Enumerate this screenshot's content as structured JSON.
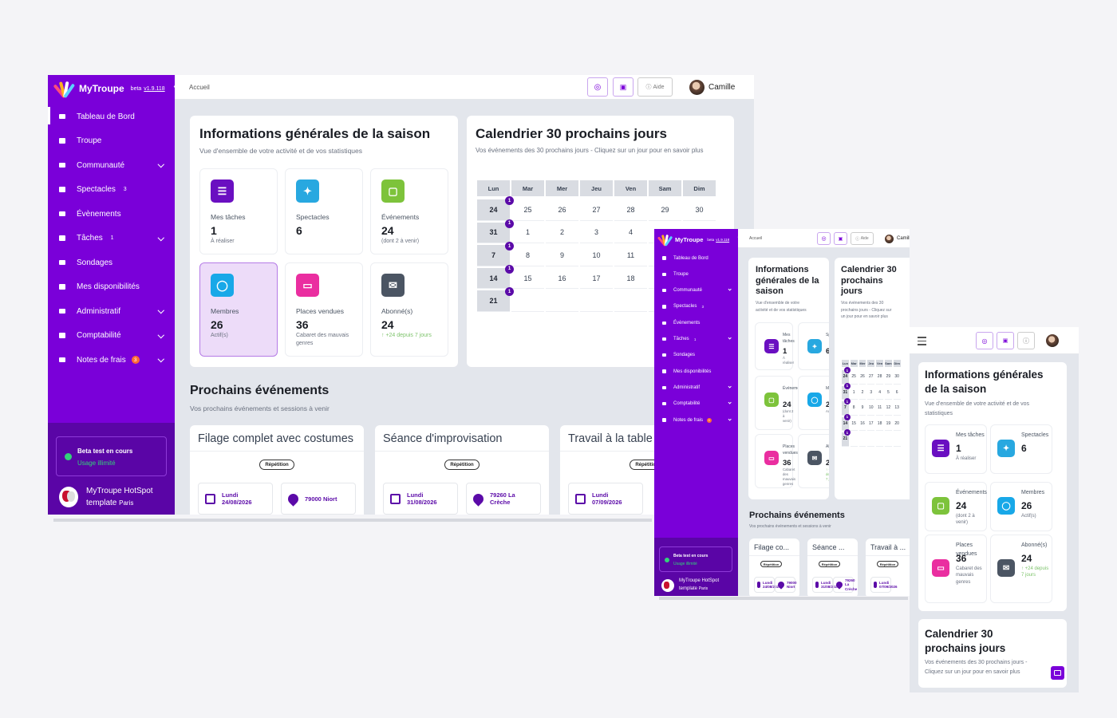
{
  "app": {
    "name": "MyTroupe",
    "beta": "beta",
    "version": "v1.9.118"
  },
  "breadcrumb": "Accueil",
  "topbar": {
    "help": "Aide",
    "user": "Camille"
  },
  "sidebar": {
    "items": [
      {
        "label": "Tableau de Bord",
        "icon": "chart-icon"
      },
      {
        "label": "Troupe",
        "icon": "home-icon"
      },
      {
        "label": "Communauté",
        "icon": "users-icon",
        "chevron": true
      },
      {
        "label": "Spectacles",
        "icon": "video-icon",
        "count": "3"
      },
      {
        "label": "Évènements",
        "icon": "calendar-icon"
      },
      {
        "label": "Tâches",
        "icon": "bookmark-icon",
        "count": "1",
        "chevron": true
      },
      {
        "label": "Sondages",
        "icon": "clipboard-icon"
      },
      {
        "label": "Mes disponibilités",
        "icon": "check-icon"
      },
      {
        "label": "Administratif",
        "icon": "folder-icon",
        "chevron": true
      },
      {
        "label": "Comptabilité",
        "icon": "calculator-icon",
        "chevron": true
      },
      {
        "label": "Notes de frais",
        "icon": "receipt-icon",
        "badge": "3",
        "chevron": true
      }
    ],
    "beta_title": "Beta test en cours",
    "beta_sub": "Usage illimité",
    "org_name": "MyTroupe HotSpot template",
    "org_city": "Paris"
  },
  "season": {
    "title": "Informations générales de la saison",
    "subtitle": "Vue d'ensemble de votre activité et de vos statistiques",
    "title_s2": [
      "Informations",
      "générales de la",
      "saison"
    ],
    "subtitle_s2": [
      "Vue d'ensemble de votre",
      "activité et de vos statistiques"
    ],
    "title_s3": [
      "Informations générales",
      "de la saison"
    ],
    "subtitle_s3": [
      "Vue d'ensemble de votre activité et de vos",
      "statistiques"
    ],
    "stats": [
      {
        "label": "Mes tâches",
        "value": "1",
        "sub": "À réaliser",
        "color": "#6a0fc1",
        "icon": "list-icon"
      },
      {
        "label": "Spectacles",
        "value": "6",
        "sub": "",
        "color": "#28a8e0",
        "icon": "sparkle-icon"
      },
      {
        "label": "Événements",
        "value": "24",
        "sub": "(dont 2 à venir)",
        "color": "#7dc33b",
        "icon": "calendar-icon"
      },
      {
        "label": "Membres",
        "value": "26",
        "sub": "Actif(s)",
        "color": "#18a8e8",
        "icon": "user-icon"
      },
      {
        "label": "Places vendues",
        "value": "36",
        "sub": "Cabaret des mauvais genres",
        "color": "#ea2ea0",
        "icon": "ticket-icon"
      },
      {
        "label": "Abonné(s)",
        "value": "24",
        "sub": "↑ +24 depuis 7 jours",
        "color": "#4b5563",
        "icon": "mail-icon"
      }
    ]
  },
  "calendar": {
    "title": "Calendrier 30 prochains jours",
    "subtitle": "Vos événements des 30 prochains jours - Cliquez sur un jour pour en savoir plus",
    "title_s2": [
      "Calendrier 30",
      "prochains",
      "jours"
    ],
    "subtitle_s2": [
      "Vos événements des 30",
      "prochains jours - Cliquez sur",
      "un jour pour en savoir plus"
    ],
    "title_s3": [
      "Calendrier 30",
      "prochains jours"
    ],
    "subtitle_s3": [
      "Vos événements des 30 prochains jours -",
      "Cliquez sur un jour pour en savoir plus"
    ],
    "days": [
      "Lun",
      "Mar",
      "Mer",
      "Jeu",
      "Ven",
      "Sam",
      "Dim"
    ],
    "weeks": [
      [
        "24",
        "25",
        "26",
        "27",
        "28",
        "29",
        "30"
      ],
      [
        "31",
        "1",
        "2",
        "3",
        "4",
        "5",
        "6"
      ],
      [
        "7",
        "8",
        "9",
        "10",
        "11",
        "12",
        "13"
      ],
      [
        "14",
        "15",
        "16",
        "17",
        "18",
        "19",
        "20"
      ],
      [
        "21",
        "",
        "",
        "",
        "",
        "",
        ""
      ]
    ],
    "event_count": "1"
  },
  "events": {
    "title": "Prochains événements",
    "subtitle": "Vos prochains événements et sessions à venir",
    "items": [
      {
        "title": "Filage complet avec costumes",
        "title_short": "Filage co...",
        "tag": "Répétition",
        "day": "Lundi",
        "date": "24/08/2026",
        "place": "79000 Niort"
      },
      {
        "title": "Séance d'improvisation",
        "title_short": "Séance ...",
        "tag": "Répétition",
        "day": "Lundi",
        "date": "31/08/2026",
        "place": "79260 La Crèche"
      },
      {
        "title": "Travail à la table",
        "title_short": "Travail à ...",
        "tag": "Répétition",
        "day": "Lundi",
        "date": "07/09/2026",
        "place": ""
      }
    ]
  }
}
